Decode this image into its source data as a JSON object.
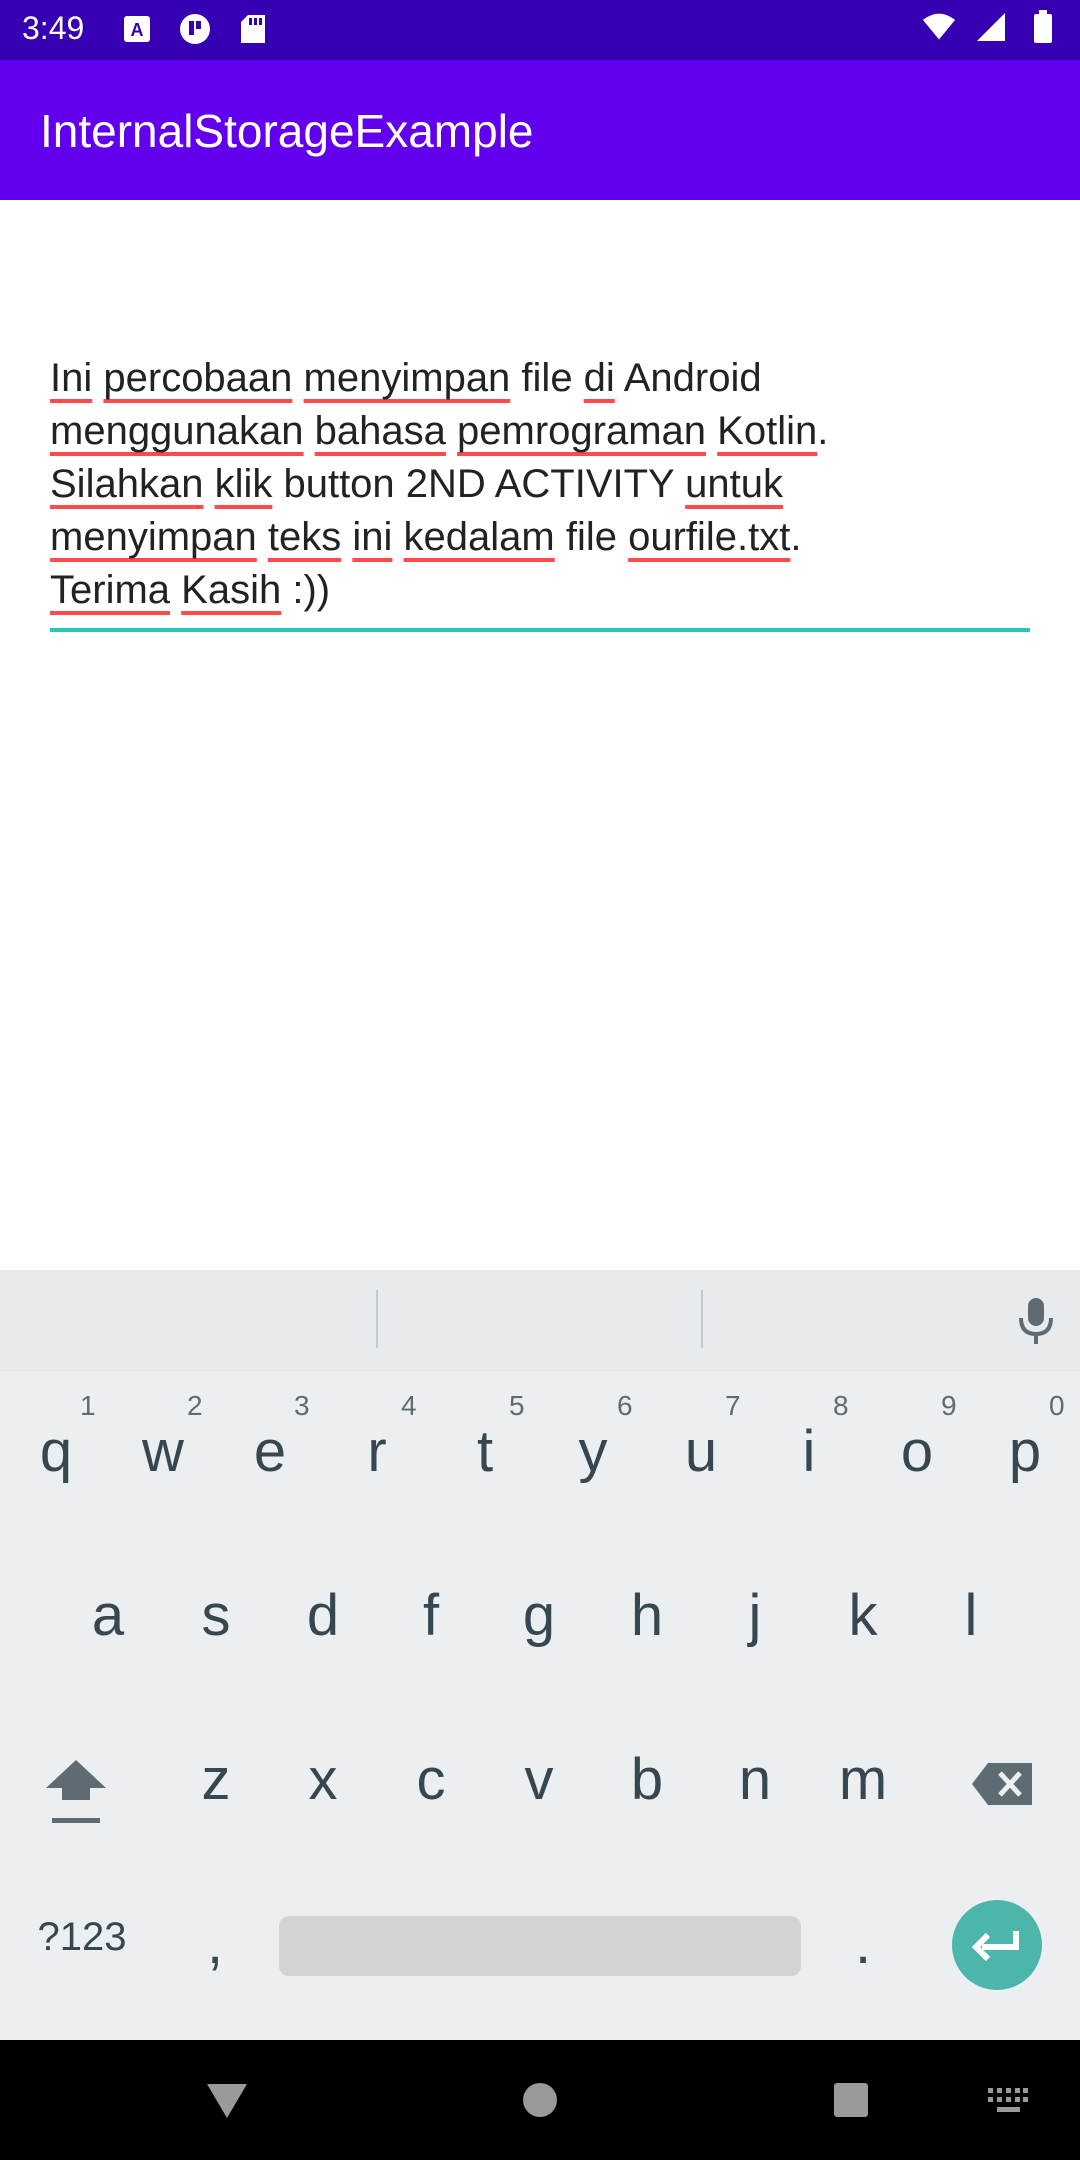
{
  "status_bar": {
    "time": "3:49",
    "left_icons": [
      "a-notification-icon",
      "circle-app-icon",
      "sd-card-icon"
    ],
    "right_icons": [
      "wifi-icon",
      "signal-icon",
      "battery-icon"
    ]
  },
  "app_bar": {
    "title": "InternalStorageExample"
  },
  "editor": {
    "lines": [
      [
        {
          "t": "Ini",
          "sp": true
        },
        {
          "t": " "
        },
        {
          "t": "percobaan",
          "sp": true
        },
        {
          "t": " "
        },
        {
          "t": "menyimpan",
          "sp": true
        },
        {
          "t": " file "
        },
        {
          "t": "di",
          "sp": true
        },
        {
          "t": " Android"
        }
      ],
      [
        {
          "t": "menggunakan",
          "sp": true
        },
        {
          "t": " "
        },
        {
          "t": "bahasa",
          "sp": true
        },
        {
          "t": " "
        },
        {
          "t": "pemrograman",
          "sp": true
        },
        {
          "t": " "
        },
        {
          "t": "Kotlin",
          "sp": true
        },
        {
          "t": "."
        }
      ],
      [
        {
          "t": "Silahkan",
          "sp": true
        },
        {
          "t": " "
        },
        {
          "t": "klik",
          "sp": true
        },
        {
          "t": " button 2ND ACTIVITY "
        },
        {
          "t": "untuk",
          "sp": true
        }
      ],
      [
        {
          "t": "menyimpan",
          "sp": true
        },
        {
          "t": " "
        },
        {
          "t": "teks",
          "sp": true
        },
        {
          "t": " "
        },
        {
          "t": "ini",
          "sp": true
        },
        {
          "t": " "
        },
        {
          "t": "kedalam",
          "sp": true
        },
        {
          "t": " file "
        },
        {
          "t": "ourfile.txt",
          "sp": true
        },
        {
          "t": "."
        }
      ],
      [
        {
          "t": "Terima",
          "sp": true
        },
        {
          "t": " "
        },
        {
          "t": "Kasih",
          "sp": true
        },
        {
          "t": " :))"
        }
      ]
    ],
    "colors": {
      "underline": "#26c6b0",
      "spellcheck": "#ff4b4b"
    }
  },
  "keyboard": {
    "row1": [
      {
        "k": "q",
        "h": "1"
      },
      {
        "k": "w",
        "h": "2"
      },
      {
        "k": "e",
        "h": "3"
      },
      {
        "k": "r",
        "h": "4"
      },
      {
        "k": "t",
        "h": "5"
      },
      {
        "k": "y",
        "h": "6"
      },
      {
        "k": "u",
        "h": "7"
      },
      {
        "k": "i",
        "h": "8"
      },
      {
        "k": "o",
        "h": "9"
      },
      {
        "k": "p",
        "h": "0"
      }
    ],
    "row2": [
      "a",
      "s",
      "d",
      "f",
      "g",
      "h",
      "j",
      "k",
      "l"
    ],
    "row3": [
      "z",
      "x",
      "c",
      "v",
      "b",
      "n",
      "m"
    ],
    "symbols_label": "?123",
    "comma": ",",
    "period": ".",
    "icons": [
      "mic-icon",
      "shift-icon",
      "backspace-icon",
      "enter-icon"
    ]
  },
  "nav_bar": {
    "icons": [
      "back-icon",
      "home-icon",
      "recents-icon",
      "keyboard-switch-icon"
    ]
  }
}
